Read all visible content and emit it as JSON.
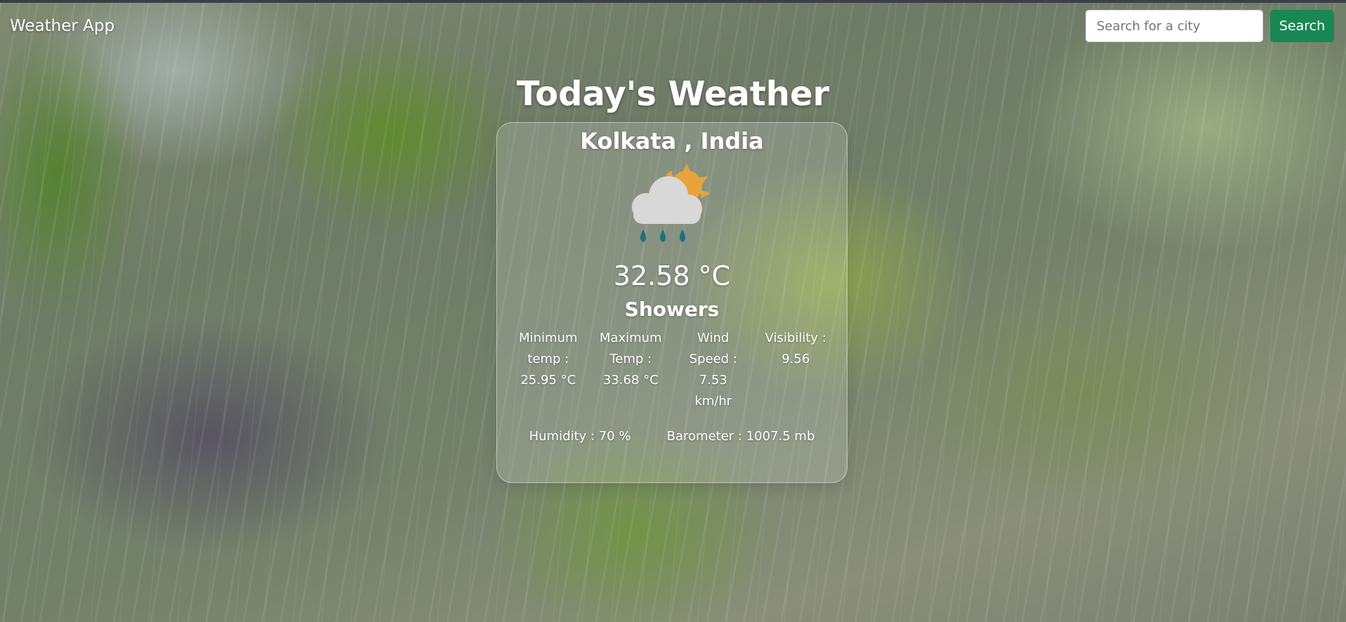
{
  "navbar": {
    "brand": "Weather App",
    "search_placeholder": "Search for a city",
    "search_button": "Search"
  },
  "page": {
    "title": "Today's Weather"
  },
  "weather": {
    "location": "Kolkata , India",
    "icon": "sun-behind-rain-cloud-icon",
    "temperature": "32.58 °C",
    "description": "Showers",
    "min_temp": {
      "label_line1": "Minimum",
      "label_line2": "temp :",
      "value": "25.95 °C"
    },
    "max_temp": {
      "label_line1": "Maximum",
      "label_line2": "Temp :",
      "value": "33.68 °C"
    },
    "wind": {
      "label_line1": "Wind",
      "label_line2": "Speed :",
      "value": "7.53",
      "unit": "km/hr"
    },
    "visibility": {
      "label": "Visibility :",
      "value": "9.56"
    },
    "humidity": "Humidity : 70 %",
    "barometer": "Barometer : 1007.5 mb"
  },
  "colors": {
    "search_button": "#198754",
    "card_border": "rgba(255,255,255,0.45)"
  }
}
